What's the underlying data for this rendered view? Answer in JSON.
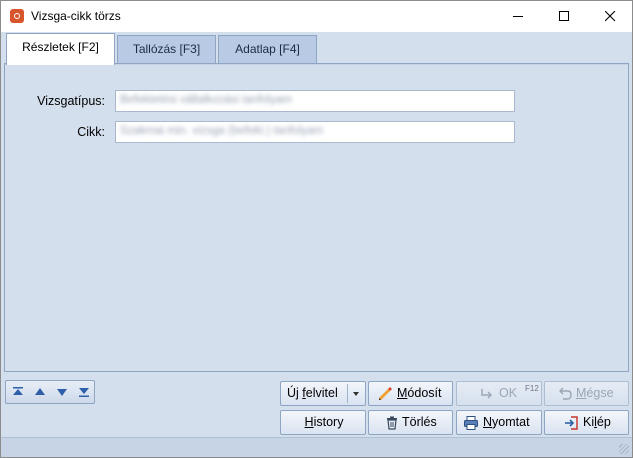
{
  "window": {
    "title": "Vizsga-cikk törzs",
    "icon": "app-logo-icon",
    "controls": [
      "minimize-icon",
      "maximize-icon",
      "close-icon"
    ]
  },
  "tabs": [
    {
      "label": "Részletek [F2]",
      "active": true
    },
    {
      "label": "Tallózás [F3]",
      "active": false
    },
    {
      "label": "Adatlap [F4]",
      "active": false
    }
  ],
  "form": {
    "vizsgatipus_label": "Vizsgatípus:",
    "vizsgatipus_value": "Befektetési vállalkozási tanfolyam",
    "cikk_label": "Cikk:",
    "cikk_value": "Szakmai min. vizsga (befekt.) tanfolyam"
  },
  "navigation": {
    "icons": [
      "first-record-icon",
      "previous-record-icon",
      "next-record-icon",
      "last-record-icon"
    ]
  },
  "buttons": {
    "new_pre": "Új ",
    "new_u": "f",
    "new_post": "elvitel",
    "modify_pre": "",
    "modify_u": "M",
    "modify_post": "ódosít",
    "ok_label": "OK",
    "ok_shortcut": "F12",
    "cancel_pre": "",
    "cancel_u": "M",
    "cancel_post": "égse",
    "history_pre": "",
    "history_u": "H",
    "history_post": "istory",
    "delete_label": "Törlés",
    "print_pre": "",
    "print_u": "N",
    "print_post": "yomtat",
    "exit_pre": "Ki",
    "exit_u": "l",
    "exit_post": "ép"
  },
  "colors": {
    "window_bg": "#d4dfee",
    "tab_inactive": "#b9cbe4",
    "border": "#8ea5c4",
    "disabled_text": "#9aa6b6"
  }
}
